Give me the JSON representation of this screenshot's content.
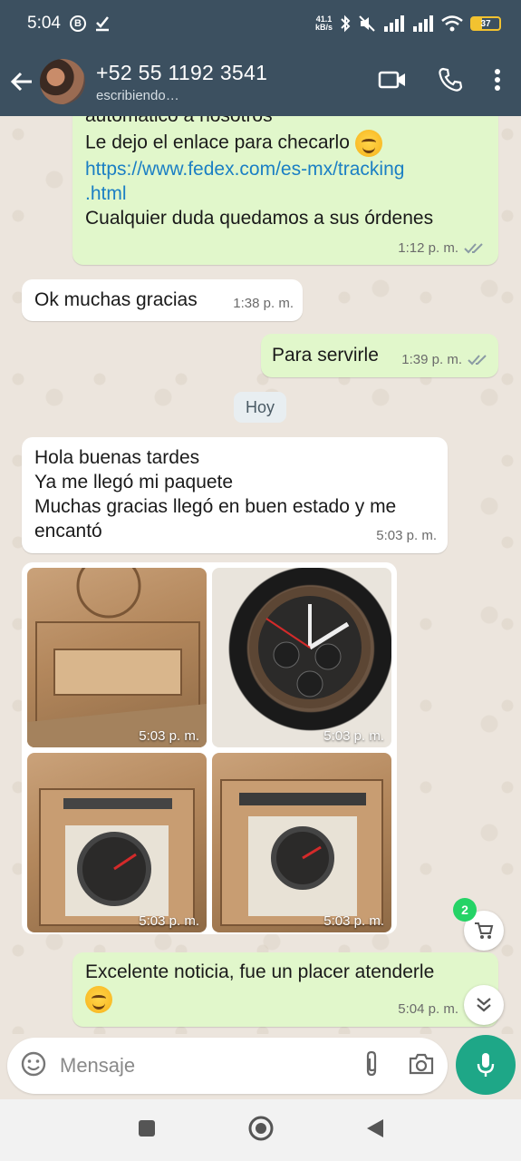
{
  "status_bar": {
    "time": "5:04",
    "net_speed_value": "41.1",
    "net_speed_unit": "kB/s",
    "battery": "37"
  },
  "header": {
    "contact_name": "+52 55 1192 3541",
    "contact_status": "escribiendo…"
  },
  "messages": {
    "m1": {
      "partial_line": "automático a nosotros",
      "line2": "Le dejo el enlace para checarlo",
      "link_line1": "https://www.fedex.com/es-mx/tracking",
      "link_line2": ".html",
      "line4": "Cualquier duda quedamos a sus órdenes",
      "time": "1:12 p. m."
    },
    "m2": {
      "text": "Ok muchas gracias",
      "time": "1:38 p. m."
    },
    "m3": {
      "text": "Para servirle",
      "time": "1:39 p. m."
    },
    "date_chip": "Hoy",
    "m4": {
      "line1": "Hola buenas tardes",
      "line2": "Ya me llegó mi paquete",
      "line3": "Muchas gracias llegó en buen estado y me",
      "line4": "encantó",
      "time": "5:03 p. m."
    },
    "photos": [
      {
        "time": "5:03 p. m."
      },
      {
        "time": "5:03 p. m."
      },
      {
        "time": "5:03 p. m."
      },
      {
        "time": "5:03 p. m."
      }
    ],
    "m5": {
      "text": "Excelente noticia, fue un placer atenderle",
      "time": "5:04 p. m."
    }
  },
  "floating": {
    "cart_badge": "2"
  },
  "composer": {
    "placeholder": "Mensaje"
  },
  "colors": {
    "header_bg": "#3c5060",
    "outgoing_bubble": "#e1f7cb",
    "incoming_bubble": "#ffffff",
    "mic_button": "#1ea787",
    "link": "#1b7fc4",
    "read_ticks": "#8a9aa4"
  }
}
